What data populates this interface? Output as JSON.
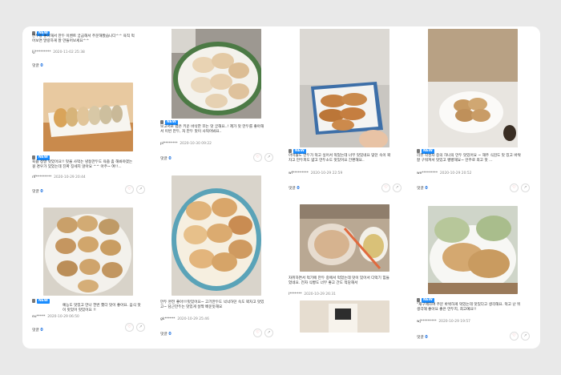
{
  "badge_label": "NEW",
  "comment_label": "댓글",
  "like_glyph": "♡",
  "share_glyph": "↗",
  "cards": [
    {
      "text": "만두랑 좋아해서 만두 이벤트 궁금해서 주문해봤습니다^^ 육직 먹어보면 말랑하게 잘 만들어보세요^^",
      "user": "ljj*********",
      "date": "2020-11-02 25:38",
      "comments": "0"
    },
    {
      "text": "육즙 정말 맛있어요!! 맛을 사먹는 냉동만두도 육즙 좀 해봐야겠는 걸 경우가 있었는데 진짜 징세지 않아요 ^^ 아주~ 여!!...",
      "user": "rlf*********",
      "date": "2020-10-29 20:44",
      "comments": "0"
    },
    {
      "text": "예능도 맛있고 만나 한번 했다 맛이 좋아요. 음식 맛이 맛있어 맛있어요 !!",
      "user": "eu*****",
      "date": "2020-10-29 06:50",
      "comments": "0"
    },
    {
      "text": "보고서로 랩은 키운 바삭한 쪼는 맛 궁해요..! 제가 맛 만두를 좋아해서 이번 만두, 처 만두 맛이 사먹어봐요..",
      "user": "pl********",
      "date": "2020-10-30 09:22",
      "comments": "0"
    },
    {
      "text": "만두 완전 좋아!!!맛있어요~ 고기만두도 넉넉하던 속도 꽉차고 맛있고~ 담근만두는 맛있게 살짝 배운듯해요",
      "user": "gk******",
      "date": "2020-10-29 25:46",
      "comments": "0"
    },
    {
      "text": "아이들도 만두가 먹고 싶어서 먹었는데 너무 맛있네요 맞던 속이 꽉차고 만두피도 얇고 만두소도 맛있어요 간편해요..",
      "user": "wf*********",
      "date": "2020-10-29 22:59",
      "comments": "0"
    },
    {
      "text": "자취하면서 먹기에 만두 중에서 먹었는데 맛이 있어서 다먹기 힘들었네요. 전자 식빵도 너무 좋고 간도 적당해서",
      "user": "l*******",
      "date": "2020-10-29 26:31",
      "comments": ""
    },
    {
      "text": "리뷰 작성자 중의 하나의 만두 맛있어요 ~ 해주 식감도 맛 있고 바싹 잘 구워져서 맛있고 빵빵해요~ 안주로 최고 맛 ...",
      "user": "we*********",
      "date": "2020-10-29 20:52",
      "comments": "0"
    },
    {
      "text": "\"재구매하여 주문 바싹하게 먹었는데 맛있다고 생각해요. 먹고 난 뒤 생각해 좋아요 좋은 만두지, 최고예요!!",
      "user": "wj*********",
      "date": "2020-10-29 19:57",
      "comments": "0"
    }
  ]
}
